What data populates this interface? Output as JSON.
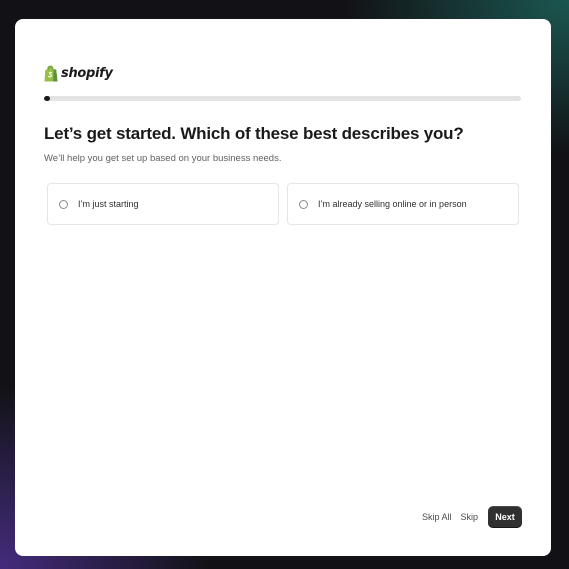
{
  "brand": {
    "logo_icon": "shopify-bag-icon",
    "name": "shopify",
    "logo_color": "#95bf47"
  },
  "progress": {
    "fraction": 0.012
  },
  "question": {
    "title": "Let’s get started. Which of these best describes you?",
    "subtitle": "We’ll help you get set up based on your business needs.",
    "options": [
      {
        "label": "I’m just starting",
        "selected": false
      },
      {
        "label": "I’m already selling online or in person",
        "selected": false
      }
    ]
  },
  "footer": {
    "skip_all_label": "Skip All",
    "skip_label": "Skip",
    "next_label": "Next"
  }
}
